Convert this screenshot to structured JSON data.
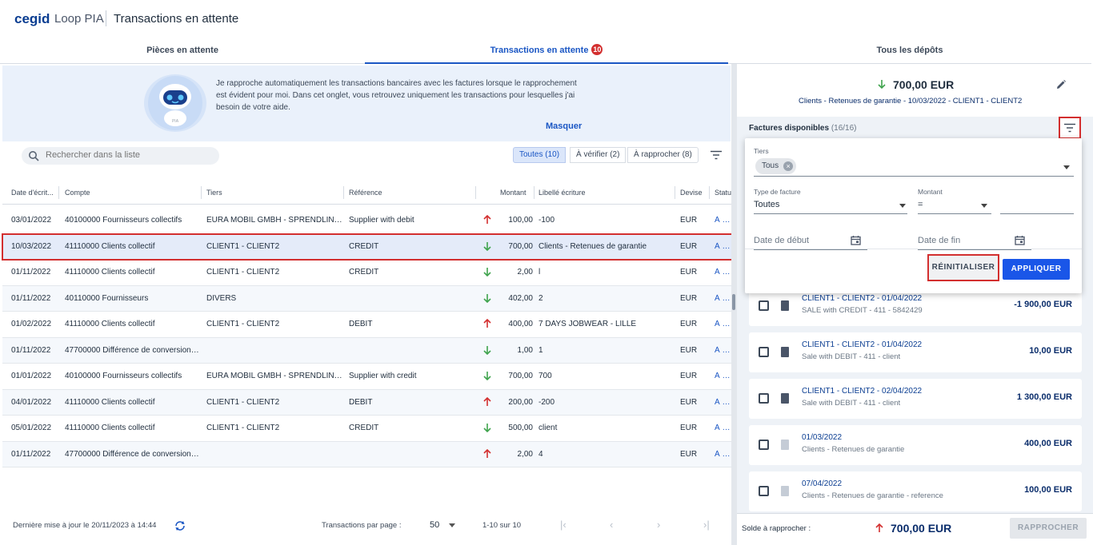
{
  "header": {
    "logo": "cegid",
    "app_name": "Loop PIA",
    "page_title": "Transactions en attente"
  },
  "tabs": [
    {
      "label": "Pièces en attente"
    },
    {
      "label": "Transactions en attente",
      "badge": "10"
    },
    {
      "label": "Tous les dépôts"
    }
  ],
  "banner": {
    "robot_label": "PIA",
    "text": "Je rapproche automatiquement les transactions bancaires avec les factures lorsque le rapprochement est évident pour moi. Dans cet onglet, vous retrouvez uniquement les transactions pour lesquelles j'ai besoin de votre aide.",
    "hide_link": "Masquer"
  },
  "search": {
    "placeholder": "Rechercher dans la liste"
  },
  "filters": {
    "all": "Toutes (10)",
    "to_check": "À vérifier (2)",
    "to_reconcile": "À rapprocher (8)"
  },
  "table": {
    "headers": {
      "date": "Date d'écrit...",
      "compte": "Compte",
      "tiers": "Tiers",
      "reference": "Référence",
      "montant": "Montant",
      "libelle": "Libellé écriture",
      "devise": "Devise",
      "statut": "Statu"
    },
    "rows": [
      {
        "date": "03/01/2022",
        "compte": "40100000 Fournisseurs collectifs",
        "tiers": "EURA MOBIL GMBH - SPRENDLINGE...",
        "reference": "Supplier with debit",
        "dir": "up",
        "montant": "100,00",
        "libelle": "-100",
        "devise": "EUR",
        "statut": "À rap"
      },
      {
        "date": "10/03/2022",
        "compte": "41110000 Clients collectif",
        "tiers": "CLIENT1 - CLIENT2",
        "reference": "CREDIT",
        "dir": "down",
        "montant": "700,00",
        "libelle": "Clients - Retenues de garantie",
        "devise": "EUR",
        "statut": "À rap"
      },
      {
        "date": "01/11/2022",
        "compte": "41110000 Clients collectif",
        "tiers": "CLIENT1 - CLIENT2",
        "reference": "CREDIT",
        "dir": "down",
        "montant": "2,00",
        "libelle": "l",
        "devise": "EUR",
        "statut": "À rap"
      },
      {
        "date": "01/11/2022",
        "compte": "40110000 Fournisseurs",
        "tiers": "DIVERS",
        "reference": "",
        "dir": "down",
        "montant": "402,00",
        "libelle": "2",
        "devise": "EUR",
        "statut": "À rap"
      },
      {
        "date": "01/02/2022",
        "compte": "41110000 Clients collectif",
        "tiers": "CLIENT1 - CLIENT2",
        "reference": "DEBIT",
        "dir": "up",
        "montant": "400,00",
        "libelle": "7 DAYS JOBWEAR - LILLE",
        "devise": "EUR",
        "statut": "À rap"
      },
      {
        "date": "01/11/2022",
        "compte": "47700000 Différence de conversion ...",
        "tiers": "",
        "reference": "",
        "dir": "down",
        "montant": "1,00",
        "libelle": "1",
        "devise": "EUR",
        "statut": "À vér"
      },
      {
        "date": "01/01/2022",
        "compte": "40100000 Fournisseurs collectifs",
        "tiers": "EURA MOBIL GMBH - SPRENDLINGE...",
        "reference": "Supplier with credit",
        "dir": "down",
        "montant": "700,00",
        "libelle": "700",
        "devise": "EUR",
        "statut": "À rap"
      },
      {
        "date": "04/01/2022",
        "compte": "41110000 Clients collectif",
        "tiers": "CLIENT1 - CLIENT2",
        "reference": "DEBIT",
        "dir": "up",
        "montant": "200,00",
        "libelle": "-200",
        "devise": "EUR",
        "statut": "À rap"
      },
      {
        "date": "05/01/2022",
        "compte": "41110000 Clients collectif",
        "tiers": "CLIENT1 - CLIENT2",
        "reference": "CREDIT",
        "dir": "down",
        "montant": "500,00",
        "libelle": "client",
        "devise": "EUR",
        "statut": "À rap"
      },
      {
        "date": "01/11/2022",
        "compte": "47700000 Différence de conversion ...",
        "tiers": "",
        "reference": "",
        "dir": "up",
        "montant": "2,00",
        "libelle": "4",
        "devise": "EUR",
        "statut": "À vér"
      }
    ]
  },
  "footer": {
    "last_update": "Dernière mise à jour le 20/11/2023 à 14:44",
    "per_page_label": "Transactions par page :",
    "per_page_value": "50",
    "range": "1-10 sur 10",
    "pager": {
      "first": "|‹",
      "prev": "‹",
      "next": "›",
      "last": "›|"
    }
  },
  "right_panel": {
    "amount": "700,00 EUR",
    "description": "Clients - Retenues de garantie - 10/03/2022 - CLIENT1 - CLIENT2",
    "invoices_label": "Factures disponibles",
    "invoices_count": "(16/16)",
    "filter_popup": {
      "tiers_label": "Tiers",
      "tiers_value": "Tous",
      "type_label": "Type de facture",
      "type_value": "Toutes",
      "montant_label": "Montant",
      "montant_operator": "=",
      "date_start_placeholder": "Date de début",
      "date_end_placeholder": "Date de fin",
      "reset": "RÉINITIALISER",
      "apply": "APPLIQUER"
    },
    "invoices": [
      {
        "title": "CLIENT1 - CLIENT2 - 01/04/2022",
        "subtitle": "SALE with CREDIT - 411 - 5842429",
        "amount": "-1 900,00 EUR",
        "doc": "dark"
      },
      {
        "title": "CLIENT1 - CLIENT2 - 01/04/2022",
        "subtitle": "Sale with DEBIT - 411 - client",
        "amount": "10,00 EUR",
        "doc": "dark"
      },
      {
        "title": "CLIENT1 - CLIENT2 - 02/04/2022",
        "subtitle": "Sale with DEBIT - 411 - client",
        "amount": "1 300,00 EUR",
        "doc": "dark"
      },
      {
        "title": "01/03/2022",
        "subtitle": "Clients - Retenues de garantie",
        "amount": "400,00 EUR",
        "doc": "light"
      },
      {
        "title": "07/04/2022",
        "subtitle": "Clients - Retenues de garantie - reference",
        "amount": "100,00 EUR",
        "doc": "light"
      }
    ],
    "solde_label": "Solde à rapprocher :",
    "solde_amount": "700,00 EUR",
    "rapprocher": "RAPPROCHER"
  },
  "colors": {
    "accent": "#1a56c4",
    "highlight": "#d32f2f",
    "up": "#d32f2f",
    "down": "#3fa34d"
  }
}
